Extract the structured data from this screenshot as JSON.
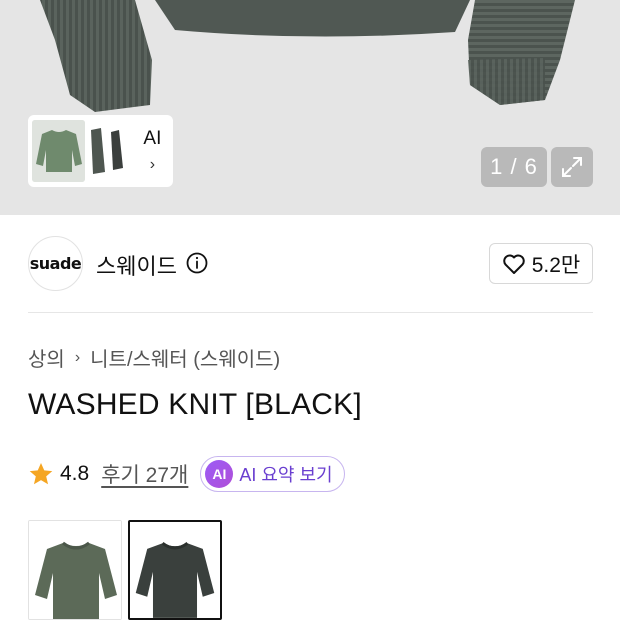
{
  "gallery": {
    "counter": "1 / 6",
    "ai_label": "AI",
    "ai_chevron": "›",
    "expand_icon": "expand-icon"
  },
  "brand": {
    "logo_text": "suade",
    "name": "스웨이드",
    "info_icon": "info-icon",
    "likes": "5.2만",
    "like_icon": "heart-icon"
  },
  "breadcrumb": {
    "items": [
      "상의",
      "니트/스웨터 (스웨이드)"
    ],
    "separator": "›"
  },
  "product": {
    "title": "WASHED KNIT [BLACK]",
    "rating": "4.8",
    "reviews": "후기 27개",
    "ai_badge": "AI",
    "ai_summary": "AI 요약 보기"
  },
  "colors": {
    "star": "#f5a623",
    "ai_purple": "#6a3fd0",
    "sweater_green": "#5c6a58",
    "sweater_black": "#3a403d"
  },
  "options": [
    {
      "name": "green-knit",
      "selected": false
    },
    {
      "name": "black-knit",
      "selected": true
    }
  ]
}
